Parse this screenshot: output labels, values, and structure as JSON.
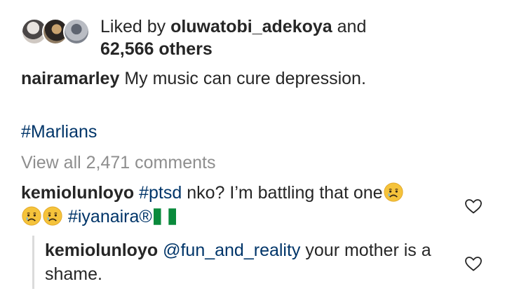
{
  "likes": {
    "prefix": "Liked by ",
    "user": "oluwatobi_adekoya",
    "conjunction": " and",
    "count_text": "62,566 others"
  },
  "post": {
    "username": "nairamarley",
    "caption": " My music can cure depression.",
    "hashtag": "#Marlians"
  },
  "view_all_comments": "View all 2,471 comments",
  "comments": [
    {
      "username": "kemiolunloyo",
      "hashtag": "#ptsd",
      "text": " nko? I’m battling that one",
      "hashtag2": "#iyanaira®",
      "emoji": "worried-face-icon",
      "flag": "nigeria-flag-icon"
    },
    {
      "username": "kemiolunloyo",
      "mention": "@fun_and_reality",
      "text": " your mother is a shame."
    }
  ],
  "colors": {
    "text": "#262626",
    "link": "#003569",
    "muted": "#8e8e8e",
    "divider": "#dbdbdb",
    "flag_green": "#0a8a3c"
  }
}
